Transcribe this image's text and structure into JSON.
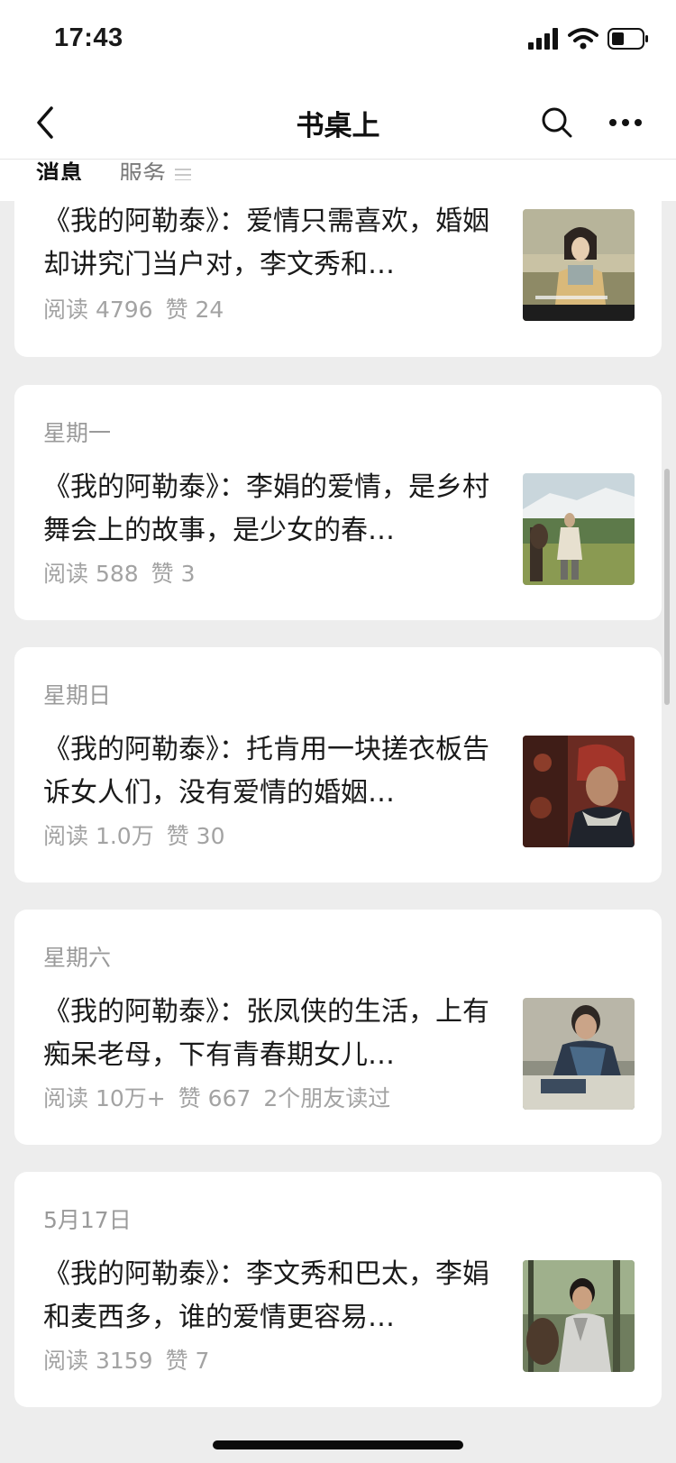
{
  "status_bar": {
    "time": "17:43"
  },
  "nav": {
    "title": "书桌上"
  },
  "tabs": {
    "messages": "消息",
    "services": "服务"
  },
  "articles": [
    {
      "date": "",
      "title": "《我的阿勒泰》：爱情只需喜欢，婚姻却讲究门当户对，李文秀和…",
      "reads": "阅读 4796",
      "likes": "赞 24",
      "friends": ""
    },
    {
      "date": "星期一",
      "title": "《我的阿勒泰》：李娟的爱情，是乡村舞会上的故事，是少女的春…",
      "reads": "阅读 588",
      "likes": "赞 3",
      "friends": ""
    },
    {
      "date": "星期日",
      "title": "《我的阿勒泰》：托肯用一块搓衣板告诉女人们，没有爱情的婚姻…",
      "reads": "阅读 1.0万",
      "likes": "赞 30",
      "friends": ""
    },
    {
      "date": "星期六",
      "title": "《我的阿勒泰》：张凤侠的生活，上有痴呆老母，下有青春期女儿…",
      "reads": "阅读 10万+",
      "likes": "赞 667",
      "friends": "2个朋友读过"
    },
    {
      "date": "5月17日",
      "title": "《我的阿勒泰》：李文秀和巴太，李娟和麦西多，谁的爱情更容易…",
      "reads": "阅读 3159",
      "likes": "赞 7",
      "friends": ""
    }
  ]
}
